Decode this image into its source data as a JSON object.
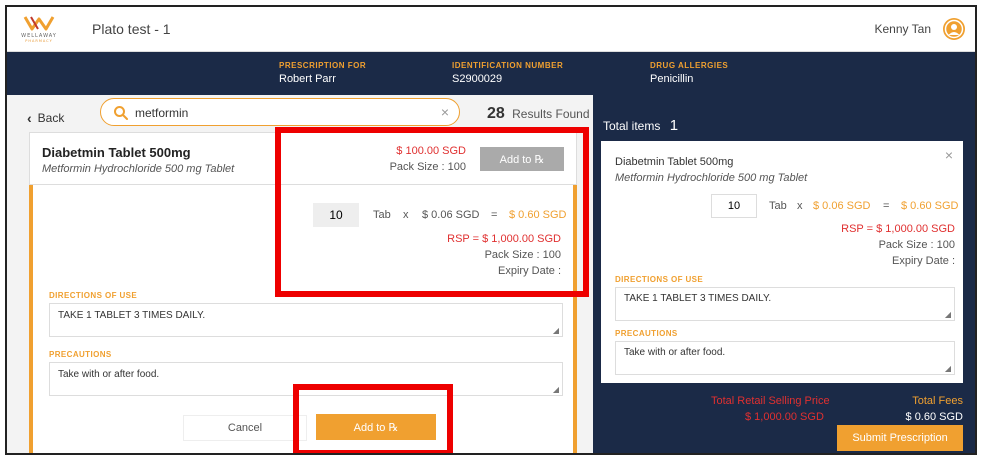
{
  "header": {
    "logo_text": "WELLAWAY",
    "logo_sub": "PHARMACY",
    "title": "Plato test - 1",
    "user": "Kenny Tan"
  },
  "patient": {
    "prescription_for_label": "PRESCRIPTION FOR",
    "prescription_for": "Robert Parr",
    "id_label": "IDENTIFICATION NUMBER",
    "id": "S2900029",
    "allergies_label": "DRUG ALLERGIES",
    "allergies": "Penicillin"
  },
  "search": {
    "back": "Back",
    "value": "metformin",
    "clear": "×",
    "results_count": "28",
    "results_label": "Results Found"
  },
  "medication": {
    "name": "Diabetmin Tablet 500mg",
    "desc": "Metformin Hydrochloride 500 mg Tablet",
    "price": "$ 100.00 SGD",
    "pack": "Pack Size : 100",
    "add_label": "Add to ℞"
  },
  "detail": {
    "qty": "10",
    "unit": "Tab",
    "times": "x",
    "unit_price": "$ 0.06 SGD",
    "eq": "=",
    "subtotal": "$ 0.60 SGD",
    "rsp": "RSP =  $ 1,000.00 SGD",
    "pack": "Pack Size : 100",
    "expiry": "Expiry Date :",
    "directions_label": "DIRECTIONS OF USE",
    "directions": "TAKE 1 TABLET 3 TIMES DAILY.",
    "precautions_label": "PRECAUTIONS",
    "precautions": "Take with or after food.",
    "cancel": "Cancel",
    "add_label": "Add to ℞"
  },
  "cart": {
    "total_items_label": "Total items",
    "total_items": "1",
    "close": "×",
    "name": "Diabetmin Tablet 500mg",
    "desc": "Metformin Hydrochloride 500 mg Tablet",
    "qty": "10",
    "unit": "Tab",
    "times": "x",
    "unit_price": "$ 0.06 SGD",
    "eq": "=",
    "subtotal": "$ 0.60 SGD",
    "rsp": "RSP =  $ 1,000.00 SGD",
    "pack": "Pack Size : 100",
    "expiry": "Expiry Date :",
    "directions_label": "DIRECTIONS OF USE",
    "directions": "TAKE 1 TABLET 3 TIMES DAILY.",
    "precautions_label": "PRECAUTIONS",
    "precautions": "Take with or after food.",
    "total_rsp_label": "Total Retail Selling Price",
    "total_rsp": "$ 1,000.00 SGD",
    "total_fees_label": "Total Fees",
    "total_fees": "$ 0.60 SGD",
    "submit": "Submit Prescription"
  },
  "colors": {
    "navy": "#1b2a47",
    "accent": "#f0a030",
    "red": "#e03030",
    "highlight": "#ee0000"
  }
}
